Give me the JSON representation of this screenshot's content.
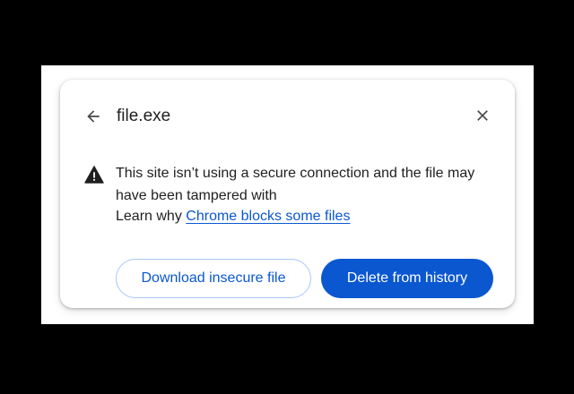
{
  "dialog": {
    "title": "file.exe",
    "back_icon": "arrow-back-icon",
    "close_icon": "close-icon",
    "warning_icon": "warning-triangle-icon",
    "message": "This site isn’t using a secure connection and the file may have been tampered with",
    "learn_prefix": "Learn why",
    "learn_link": "Chrome blocks some files",
    "buttons": {
      "secondary_label": "Download insecure file",
      "primary_label": "Delete from history"
    }
  },
  "colors": {
    "background": "#000000",
    "surface": "#ffffff",
    "text": "#1f1f1f",
    "accent": "#0b57d0",
    "outline": "#a8c7fa"
  }
}
